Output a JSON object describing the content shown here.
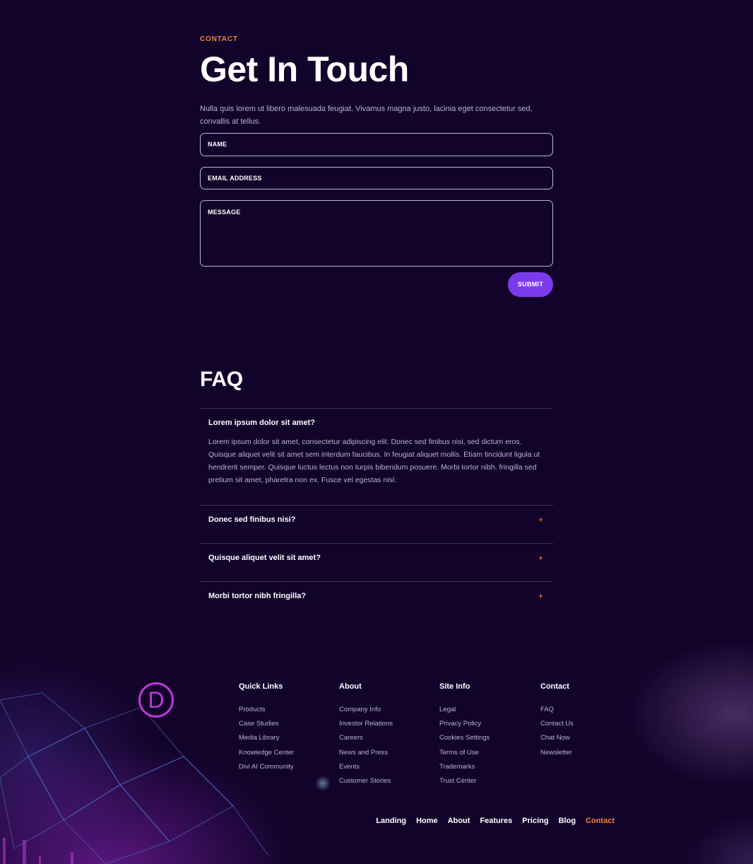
{
  "contact": {
    "eyebrow": "CONTACT",
    "title": "Get In Touch",
    "intro": "Nulla quis lorem ut libero malesuada feugiat. Vivamus magna justo, lacinia eget consectetur sed, convallis at tellus.",
    "fields": {
      "name": "NAME",
      "email": "EMAIL ADDRESS",
      "message": "MESSAGE"
    },
    "submit_label": "SUBMIT"
  },
  "faq": {
    "title": "FAQ",
    "items": [
      {
        "question": "Lorem ipsum dolor sit amet?",
        "answer": "Lorem ipsum dolor sit amet, consectetur adipiscing elit. Donec sed finibus nisi, sed dictum eros. Quisque aliquet velit sit amet sem interdum faucibus. In feugiat aliquet mollis. Etiam tincidunt ligula ut hendrerit semper. Quisque luctus lectus non turpis bibendum posuere. Morbi tortor nibh, fringilla sed pretium sit amet, pharetra non ex. Fusce vel egestas nisl.",
        "open": true
      },
      {
        "question": "Donec sed finibus nisi?",
        "open": false
      },
      {
        "question": "Quisque aliquet velit sit amet?",
        "open": false
      },
      {
        "question": "Morbi tortor nibh fringilla?",
        "open": false
      }
    ],
    "expand_icon": "+"
  },
  "footer": {
    "logo_letter": "D",
    "columns": [
      {
        "heading": "Quick Links",
        "links": [
          "Products",
          "Case Studies",
          "Media Library",
          "Knowledge Center",
          "Divi AI Community"
        ]
      },
      {
        "heading": "About",
        "links": [
          "Company Info",
          "Investor Relations",
          "Careers",
          "News and Press",
          "Events",
          "Customer Stories"
        ]
      },
      {
        "heading": "Site Info",
        "links": [
          "Legal",
          "Privacy Policy",
          "Cookies Settings",
          "Terms of Use",
          "Trademarks",
          "Trust Center"
        ]
      },
      {
        "heading": "Contact",
        "links": [
          "FAQ",
          "Contact Us",
          "Chat Now",
          "Newsletter"
        ]
      }
    ],
    "nav": [
      "Landing",
      "Home",
      "About",
      "Features",
      "Pricing",
      "Blog",
      "Contact"
    ],
    "active_nav": "Contact"
  },
  "colors": {
    "background": "#12032a",
    "accent_orange": "#f0803c",
    "button_purple": "#7c3aed",
    "logo_magenta": "#c036d8"
  }
}
